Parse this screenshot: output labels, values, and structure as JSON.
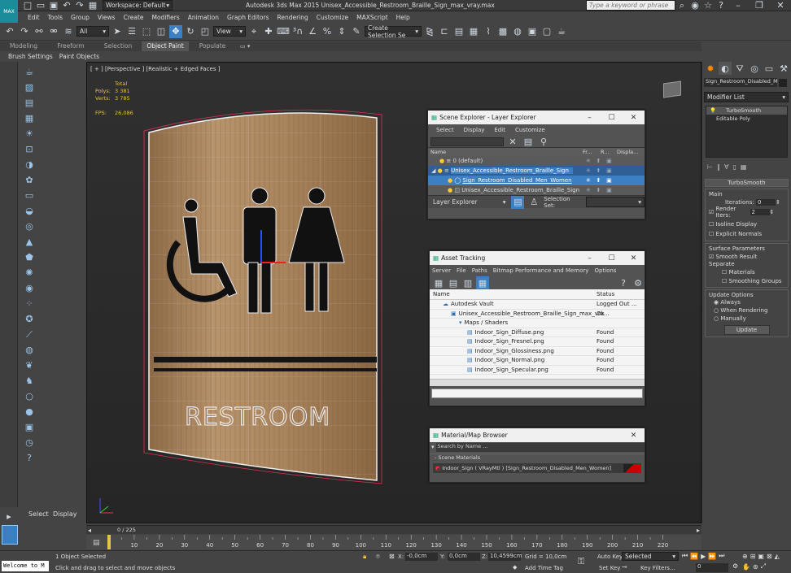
{
  "titlebar": {
    "workspace": "Workspace: Default",
    "title": "Autodesk 3ds Max  2015    Unisex_Accessible_Restroom_Braille_Sign_max_vray.max",
    "search_placeholder": "Type a keyword or phrase"
  },
  "menubar": [
    "Edit",
    "Tools",
    "Group",
    "Views",
    "Create",
    "Modifiers",
    "Animation",
    "Graph Editors",
    "Rendering",
    "Customize",
    "MAXScript",
    "Help"
  ],
  "toolbar": {
    "filter_select": "All",
    "view_select": "View",
    "selection_set": "Create Selection Se"
  },
  "ribbon_tabs": [
    "Modeling",
    "Freeform",
    "Selection",
    "Object Paint",
    "Populate"
  ],
  "ribbon_active": "Object Paint",
  "subribbon": [
    "Brush Settings",
    "Paint Objects"
  ],
  "viewport": {
    "label": "[ + ] [Perspective ] [Realistic + Edged Faces ]",
    "stats_header": "Total",
    "polys_label": "Polys:",
    "polys_value": "3 381",
    "verts_label": "Verts:",
    "verts_value": "3 785",
    "fps_label": "FPS:",
    "fps_value": "26,086",
    "sign_text": "RESTROOM"
  },
  "scene_explorer": {
    "title": "Scene Explorer - Layer Explorer",
    "menu": [
      "Select",
      "Display",
      "Edit",
      "Customize"
    ],
    "columns": [
      "Name",
      "Fr...",
      "R...",
      "Displa..."
    ],
    "rows": [
      "0 (default)",
      "Unisex_Accessible_Restroom_Braille_Sign",
      "Sign_Restroom_Disabled_Men_Women",
      "Unisex_Accessible_Restroom_Braille_Sign"
    ],
    "footer_select": "Layer Explorer",
    "footer_label": "Selection Set:"
  },
  "asset_tracking": {
    "title": "Asset Tracking",
    "menu": [
      "Server",
      "File",
      "Paths",
      "Bitmap Performance and Memory",
      "Options"
    ],
    "columns": [
      "Name",
      "Status"
    ],
    "rows": [
      {
        "name": "Autodesk Vault",
        "status": "Logged Out ..."
      },
      {
        "name": "Unisex_Accessible_Restroom_Braille_Sign_max_vra...",
        "status": "Ok"
      },
      {
        "name": "Maps / Shaders",
        "status": ""
      },
      {
        "name": "Indoor_Sign_Diffuse.png",
        "status": "Found"
      },
      {
        "name": "Indoor_Sign_Fresnel.png",
        "status": "Found"
      },
      {
        "name": "Indoor_Sign_Glossiness.png",
        "status": "Found"
      },
      {
        "name": "Indoor_Sign_Normal.png",
        "status": "Found"
      },
      {
        "name": "Indoor_Sign_Specular.png",
        "status": "Found"
      }
    ]
  },
  "material_browser": {
    "title": "Material/Map Browser",
    "search_placeholder": "Search by Name ...",
    "section": "- Scene Materials",
    "item": "Indoor_Sign ( VRayMtl ) [Sign_Restroom_Disabled_Men_Women]"
  },
  "command_panel": {
    "object_name": "Sign_Restroom_Disabled_Men",
    "modifier_list": "Modifier List",
    "stack": [
      "TurboSmooth",
      "Editable Poly"
    ],
    "rollout_title": "TurboSmooth",
    "main_label": "Main",
    "iterations_label": "Iterations:",
    "iterations_value": "0",
    "render_iters_label": "Render Iters:",
    "render_iters_value": "2",
    "isoline": "Isoline Display",
    "explicit": "Explicit Normals",
    "surface_label": "Surface Parameters",
    "smooth_result": "Smooth Result",
    "separate_label": "Separate",
    "materials": "Materials",
    "smoothing_groups": "Smoothing Groups",
    "update_label": "Update Options",
    "always": "Always",
    "when_rendering": "When Rendering",
    "manually": "Manually",
    "update_button": "Update"
  },
  "left_bottom": {
    "select": "Select",
    "display": "Display"
  },
  "timeline": {
    "frame_counter": "0 / 225",
    "ticks": [
      "0",
      "10",
      "20",
      "30",
      "40",
      "50",
      "60",
      "70",
      "80",
      "90",
      "100",
      "110",
      "120",
      "130",
      "140",
      "150",
      "160",
      "170",
      "180",
      "190",
      "200",
      "210",
      "220"
    ],
    "current_frame": 0,
    "total_frames": 225
  },
  "statusbar": {
    "maxscript": "Welcome to M",
    "status1": "1 Object Selected",
    "status2": "Click and drag to select and move objects",
    "x_label": "X:",
    "x_value": "-0,0cm",
    "y_label": "Y:",
    "y_value": "0,0cm",
    "z_label": "Z:",
    "z_value": "10,4599cm",
    "grid": "Grid = 10,0cm",
    "add_time_tag": "Add Time Tag",
    "auto_key": "Auto Key",
    "auto_key_select": "Selected",
    "set_key": "Set Key",
    "key_filters": "Key Filters...",
    "frame_field": "0"
  },
  "colors": {
    "accent": "#3c7fc2",
    "ui_bg": "#444444",
    "viewport_bg": "#2b2b2b",
    "wood": "#b08a63"
  }
}
